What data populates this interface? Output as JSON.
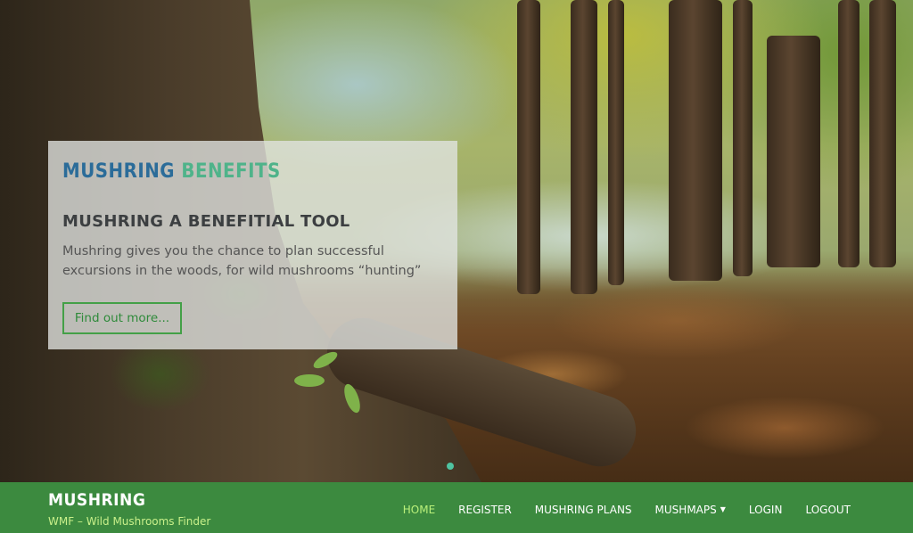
{
  "hero": {
    "card": {
      "brand_part1": "MUSHRING",
      "brand_part2": "BENEFITS",
      "heading": "MUSHRING A BENEFITIAL TOOL",
      "text": "Mushring gives you the chance to plan successful excursions in the woods, for wild mushrooms “hunting”",
      "button_label": "Find out more..."
    }
  },
  "footer": {
    "logo": "MUSHRING",
    "tagline": "WMF – Wild Mushrooms Finder",
    "nav": [
      {
        "label": "HOME",
        "active": true
      },
      {
        "label": "REGISTER"
      },
      {
        "label": "MUSHRING PLANS"
      },
      {
        "label": "MUSHMAPS"
      },
      {
        "label": "LOGIN"
      },
      {
        "label": "LOGOUT"
      }
    ]
  },
  "colors": {
    "nav_background": "#3c8a3f",
    "brand_blue": "#2b6c99",
    "brand_green": "#4fb38a",
    "active_link": "#b9f07a"
  }
}
